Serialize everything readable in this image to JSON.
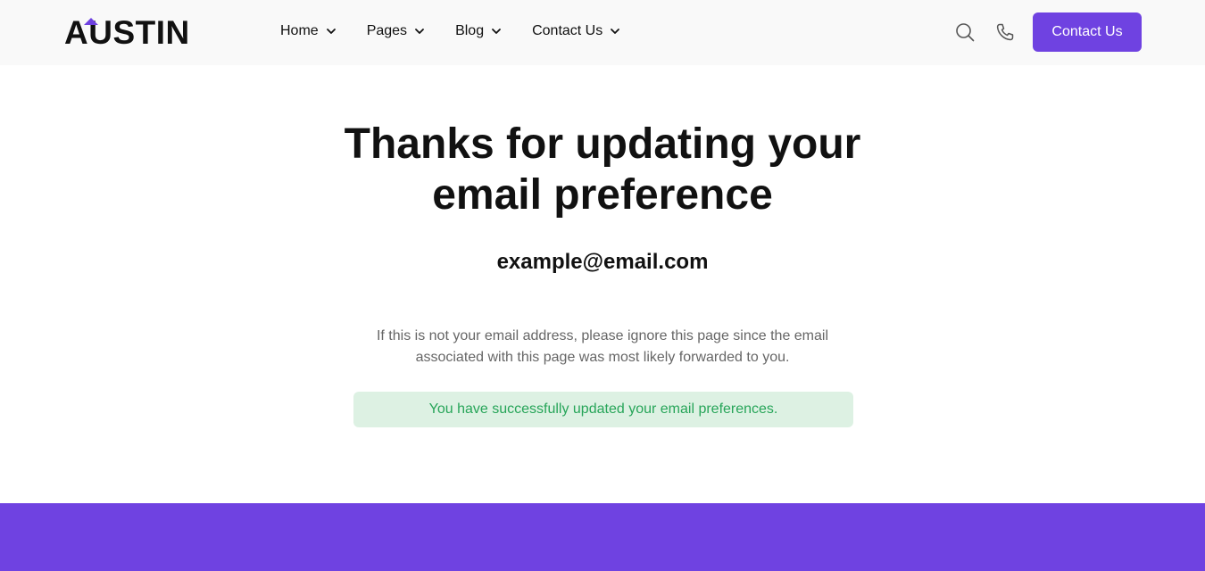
{
  "header": {
    "logo_text": "AUSTIN",
    "nav": [
      {
        "label": "Home"
      },
      {
        "label": "Pages"
      },
      {
        "label": "Blog"
      },
      {
        "label": "Contact Us"
      }
    ],
    "icons": {
      "search": "search-icon",
      "phone": "phone-icon",
      "dropdown": "chevron-down-icon"
    },
    "cta_label": "Contact Us"
  },
  "main": {
    "title": "Thanks for updating your email preference",
    "email": "example@email.com",
    "note": "If this is not your email address, please ignore this page since the email associated with this page was most likely forwarded to you.",
    "success_message": "You have successfully updated your email preferences."
  },
  "colors": {
    "accent": "#6f42e1",
    "success_bg": "#ddf1e3",
    "success_text": "#27a559",
    "header_bg": "#f9f9f9"
  }
}
